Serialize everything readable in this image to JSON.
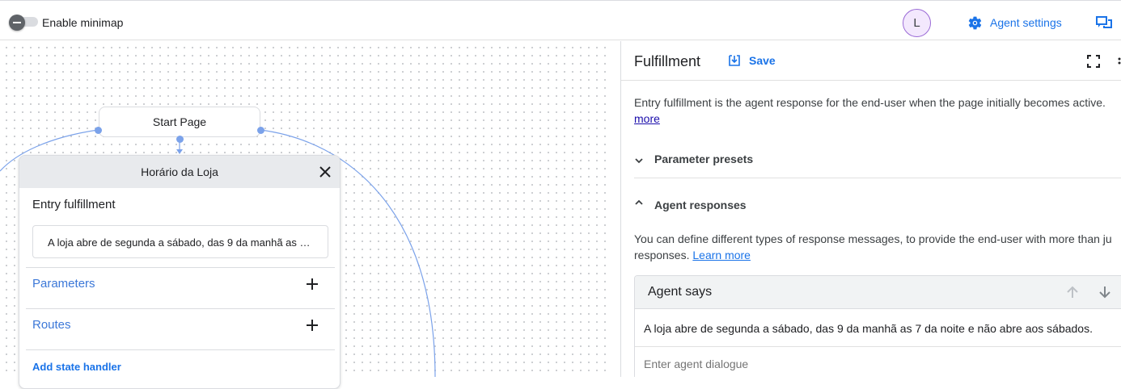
{
  "topbar": {
    "minimap_label": "Enable minimap",
    "minimap_enabled": false,
    "avatar_initial": "L",
    "agent_settings_label": "Agent settings"
  },
  "canvas": {
    "start_node_label": "Start Page",
    "page_card": {
      "title": "Horário da Loja",
      "entry_fulfillment_label": "Entry fulfillment",
      "entry_text": "A loja abre de segunda a sábado, das 9 da manhã as 7 da noite e não abre aos sábados.",
      "sections": [
        {
          "label": "Parameters"
        },
        {
          "label": "Routes"
        }
      ],
      "add_state_handler_label": "Add state handler"
    }
  },
  "panel": {
    "title": "Fulfillment",
    "save_label": "Save",
    "description": "Entry fulfillment is the agent response for the end-user when the page initially becomes active.",
    "description_link": "more",
    "parameter_presets_label": "Parameter presets",
    "agent_responses_label": "Agent responses",
    "responses_description": "You can define different types of response messages, to provide the end-user with more than ju",
    "responses_description_cont": "responses.",
    "learn_more_label": "Learn more",
    "agent_says": {
      "title": "Agent says",
      "message": "A loja abre de segunda a sábado, das 9 da manhã as 7 da noite e não abre aos sábados.",
      "input_placeholder": "Enter agent dialogue"
    }
  },
  "colors": {
    "accent": "#1a73e8",
    "link_section": "#3c78d8",
    "edge": "#7ba2ea"
  }
}
